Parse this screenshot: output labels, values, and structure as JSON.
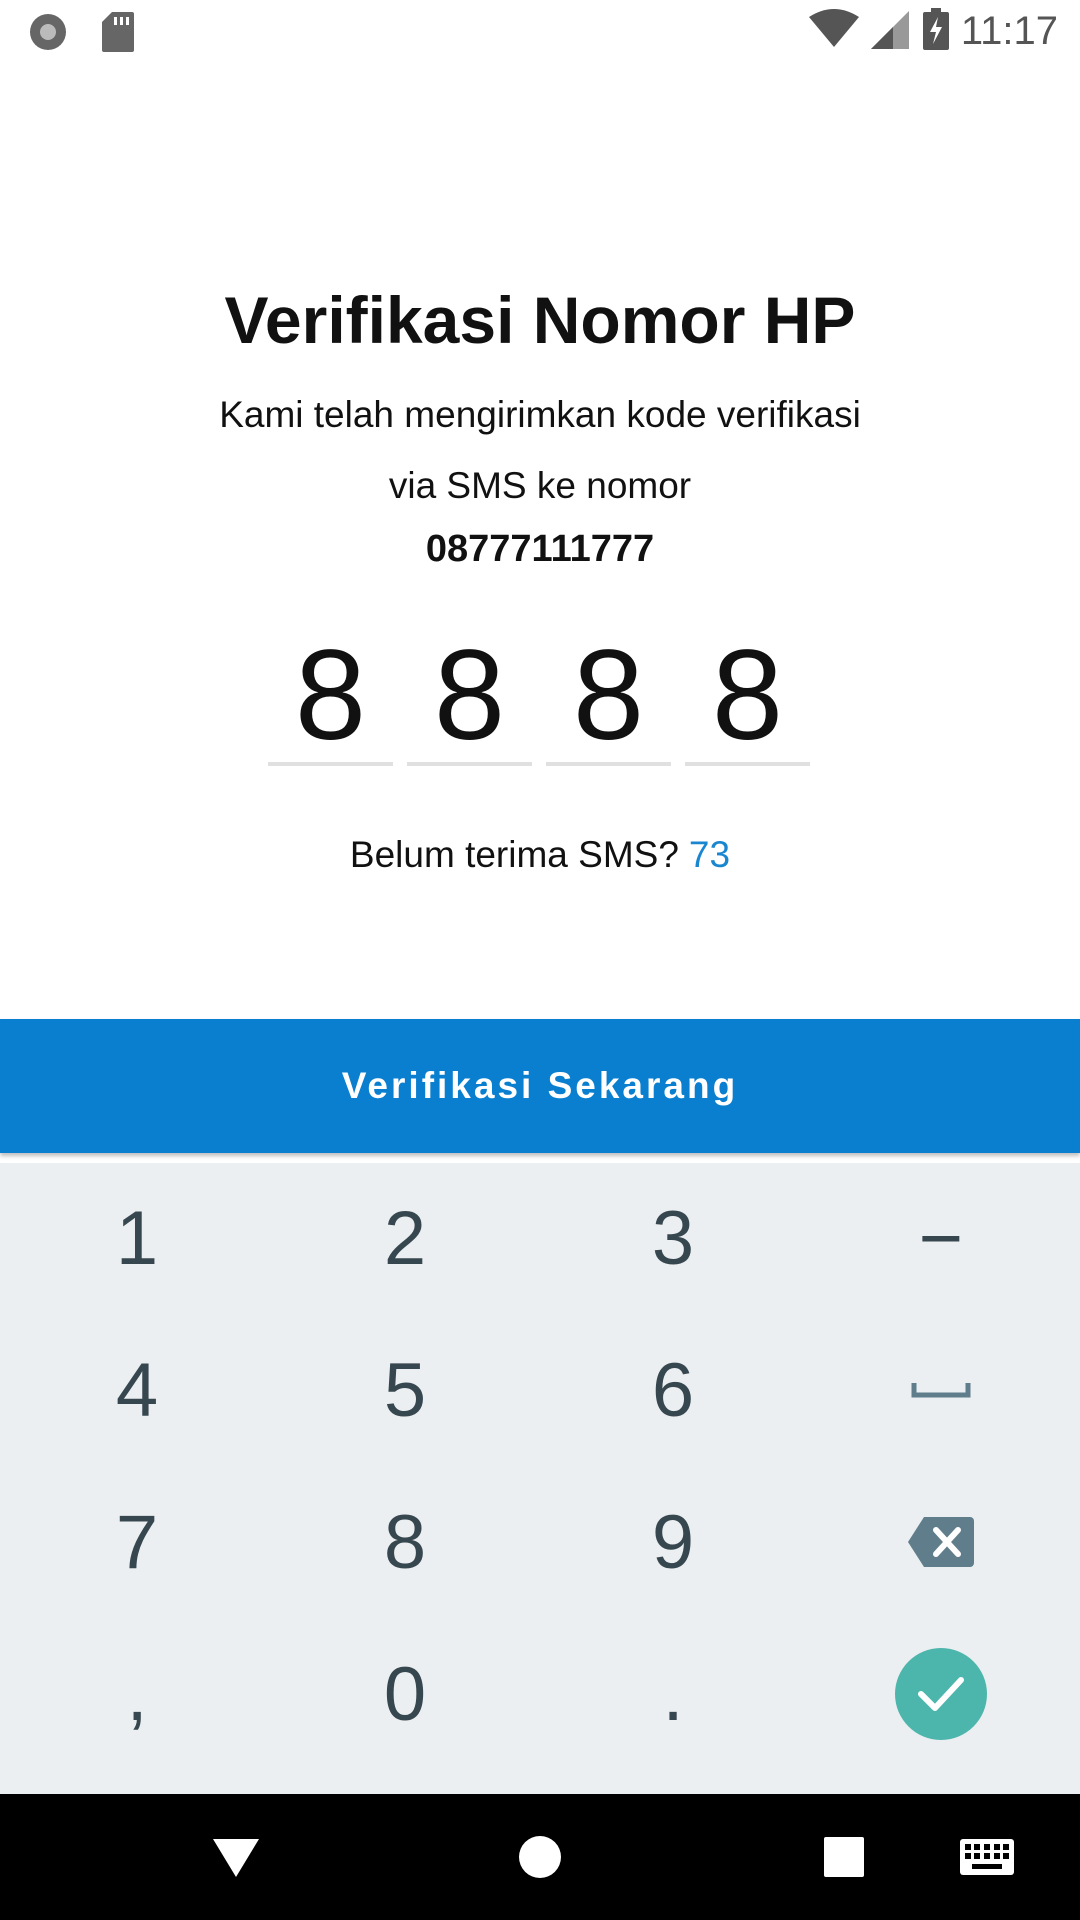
{
  "status_bar": {
    "time": "11:17",
    "icons": [
      "record-icon",
      "sd-card-icon",
      "wifi-icon",
      "cellular-signal-icon",
      "battery-charging-icon"
    ]
  },
  "verification": {
    "title": "Verifikasi Nomor HP",
    "subtitle_line1": "Kami telah mengirimkan kode verifikasi",
    "subtitle_line2": "via SMS ke nomor",
    "phone_number": "08777111777",
    "code_digits": [
      "8",
      "8",
      "8",
      "8"
    ],
    "resend_text": "Belum terima SMS?",
    "resend_countdown": "73",
    "verify_button_label": "Verifikasi Sekarang"
  },
  "keypad": {
    "rows": [
      [
        "1",
        "2",
        "3",
        "−"
      ],
      [
        "4",
        "5",
        "6",
        "space-icon"
      ],
      [
        "7",
        "8",
        "9",
        "backspace-icon"
      ],
      [
        ",",
        "0",
        ".",
        "done-check-icon"
      ]
    ]
  },
  "colors": {
    "accent": "#0a7fcf",
    "countdown": "#1a86d0",
    "keypad_bg": "#eceff1",
    "keypad_text": "#37474f",
    "done_button": "#4db6ac"
  },
  "nav_bar": {
    "icons": [
      "back-triangle-icon",
      "home-circle-icon",
      "recents-square-icon",
      "keyboard-icon"
    ]
  }
}
